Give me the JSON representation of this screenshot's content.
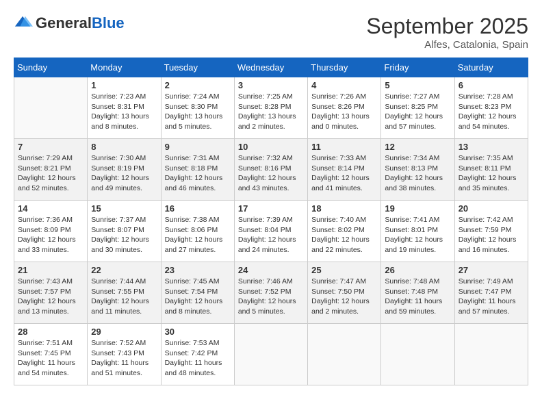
{
  "header": {
    "logo_general": "General",
    "logo_blue": "Blue",
    "month_title": "September 2025",
    "subtitle": "Alfes, Catalonia, Spain"
  },
  "days_of_week": [
    "Sunday",
    "Monday",
    "Tuesday",
    "Wednesday",
    "Thursday",
    "Friday",
    "Saturday"
  ],
  "weeks": [
    [
      {
        "day": "",
        "text": ""
      },
      {
        "day": "1",
        "text": "Sunrise: 7:23 AM\nSunset: 8:31 PM\nDaylight: 13 hours\nand 8 minutes."
      },
      {
        "day": "2",
        "text": "Sunrise: 7:24 AM\nSunset: 8:30 PM\nDaylight: 13 hours\nand 5 minutes."
      },
      {
        "day": "3",
        "text": "Sunrise: 7:25 AM\nSunset: 8:28 PM\nDaylight: 13 hours\nand 2 minutes."
      },
      {
        "day": "4",
        "text": "Sunrise: 7:26 AM\nSunset: 8:26 PM\nDaylight: 13 hours\nand 0 minutes."
      },
      {
        "day": "5",
        "text": "Sunrise: 7:27 AM\nSunset: 8:25 PM\nDaylight: 12 hours\nand 57 minutes."
      },
      {
        "day": "6",
        "text": "Sunrise: 7:28 AM\nSunset: 8:23 PM\nDaylight: 12 hours\nand 54 minutes."
      }
    ],
    [
      {
        "day": "7",
        "text": "Sunrise: 7:29 AM\nSunset: 8:21 PM\nDaylight: 12 hours\nand 52 minutes."
      },
      {
        "day": "8",
        "text": "Sunrise: 7:30 AM\nSunset: 8:19 PM\nDaylight: 12 hours\nand 49 minutes."
      },
      {
        "day": "9",
        "text": "Sunrise: 7:31 AM\nSunset: 8:18 PM\nDaylight: 12 hours\nand 46 minutes."
      },
      {
        "day": "10",
        "text": "Sunrise: 7:32 AM\nSunset: 8:16 PM\nDaylight: 12 hours\nand 43 minutes."
      },
      {
        "day": "11",
        "text": "Sunrise: 7:33 AM\nSunset: 8:14 PM\nDaylight: 12 hours\nand 41 minutes."
      },
      {
        "day": "12",
        "text": "Sunrise: 7:34 AM\nSunset: 8:13 PM\nDaylight: 12 hours\nand 38 minutes."
      },
      {
        "day": "13",
        "text": "Sunrise: 7:35 AM\nSunset: 8:11 PM\nDaylight: 12 hours\nand 35 minutes."
      }
    ],
    [
      {
        "day": "14",
        "text": "Sunrise: 7:36 AM\nSunset: 8:09 PM\nDaylight: 12 hours\nand 33 minutes."
      },
      {
        "day": "15",
        "text": "Sunrise: 7:37 AM\nSunset: 8:07 PM\nDaylight: 12 hours\nand 30 minutes."
      },
      {
        "day": "16",
        "text": "Sunrise: 7:38 AM\nSunset: 8:06 PM\nDaylight: 12 hours\nand 27 minutes."
      },
      {
        "day": "17",
        "text": "Sunrise: 7:39 AM\nSunset: 8:04 PM\nDaylight: 12 hours\nand 24 minutes."
      },
      {
        "day": "18",
        "text": "Sunrise: 7:40 AM\nSunset: 8:02 PM\nDaylight: 12 hours\nand 22 minutes."
      },
      {
        "day": "19",
        "text": "Sunrise: 7:41 AM\nSunset: 8:01 PM\nDaylight: 12 hours\nand 19 minutes."
      },
      {
        "day": "20",
        "text": "Sunrise: 7:42 AM\nSunset: 7:59 PM\nDaylight: 12 hours\nand 16 minutes."
      }
    ],
    [
      {
        "day": "21",
        "text": "Sunrise: 7:43 AM\nSunset: 7:57 PM\nDaylight: 12 hours\nand 13 minutes."
      },
      {
        "day": "22",
        "text": "Sunrise: 7:44 AM\nSunset: 7:55 PM\nDaylight: 12 hours\nand 11 minutes."
      },
      {
        "day": "23",
        "text": "Sunrise: 7:45 AM\nSunset: 7:54 PM\nDaylight: 12 hours\nand 8 minutes."
      },
      {
        "day": "24",
        "text": "Sunrise: 7:46 AM\nSunset: 7:52 PM\nDaylight: 12 hours\nand 5 minutes."
      },
      {
        "day": "25",
        "text": "Sunrise: 7:47 AM\nSunset: 7:50 PM\nDaylight: 12 hours\nand 2 minutes."
      },
      {
        "day": "26",
        "text": "Sunrise: 7:48 AM\nSunset: 7:48 PM\nDaylight: 11 hours\nand 59 minutes."
      },
      {
        "day": "27",
        "text": "Sunrise: 7:49 AM\nSunset: 7:47 PM\nDaylight: 11 hours\nand 57 minutes."
      }
    ],
    [
      {
        "day": "28",
        "text": "Sunrise: 7:51 AM\nSunset: 7:45 PM\nDaylight: 11 hours\nand 54 minutes."
      },
      {
        "day": "29",
        "text": "Sunrise: 7:52 AM\nSunset: 7:43 PM\nDaylight: 11 hours\nand 51 minutes."
      },
      {
        "day": "30",
        "text": "Sunrise: 7:53 AM\nSunset: 7:42 PM\nDaylight: 11 hours\nand 48 minutes."
      },
      {
        "day": "",
        "text": ""
      },
      {
        "day": "",
        "text": ""
      },
      {
        "day": "",
        "text": ""
      },
      {
        "day": "",
        "text": ""
      }
    ]
  ]
}
